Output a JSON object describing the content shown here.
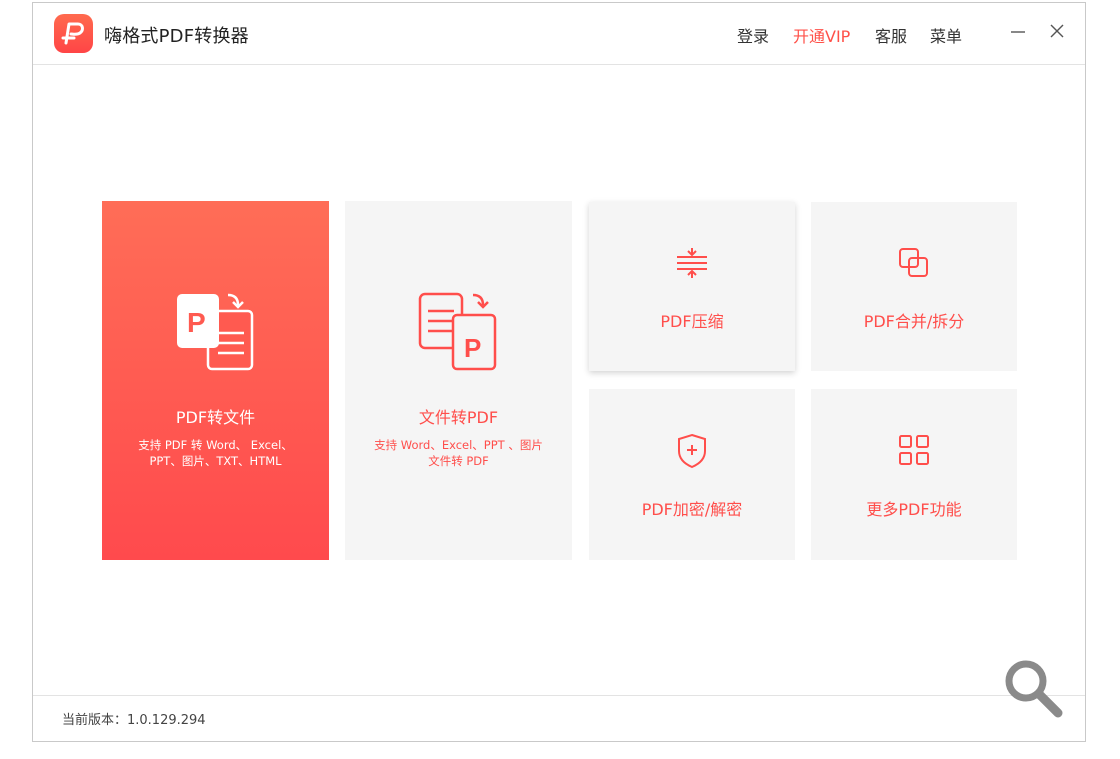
{
  "app": {
    "title": "嗨格式PDF转换器"
  },
  "header": {
    "login": "登录",
    "vip": "开通VIP",
    "service": "客服",
    "menu": "菜单"
  },
  "tiles": {
    "pdf_to_file": {
      "title": "PDF转文件",
      "desc": "支持 PDF 转 Word、 Excel、 PPT、图片、TXT、HTML"
    },
    "file_to_pdf": {
      "title": "文件转PDF",
      "desc": "支持 Word、Excel、PPT 、图片文件转 PDF"
    },
    "compress": {
      "title": "PDF压缩"
    },
    "merge_split": {
      "title": "PDF合并/拆分"
    },
    "encrypt": {
      "title": "PDF加密/解密"
    },
    "more": {
      "title": "更多PDF功能"
    }
  },
  "status": {
    "version": "当前版本：1.0.129.294"
  },
  "colors": {
    "accent": "#ff4e4b",
    "tile_bg": "#f5f5f5"
  },
  "icons": [
    "app-logo-icon",
    "minimize-icon",
    "close-icon",
    "pdf-to-file-icon",
    "file-to-pdf-icon",
    "compress-icon",
    "merge-split-icon",
    "shield-lock-icon",
    "grid-more-icon",
    "magnifier-icon"
  ]
}
